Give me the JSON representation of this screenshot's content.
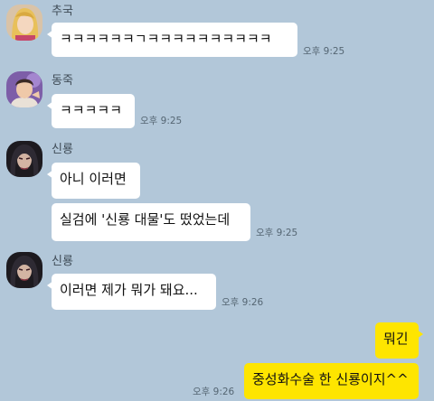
{
  "messages": [
    {
      "sender": "추국",
      "text": "ㅋㅋㅋㅋㅋㅋㄱㅋㅋㅋㅋㅋㅋㅋㅋㅋㅋ",
      "time": "오후 9:25"
    },
    {
      "sender": "동죽",
      "text": "ㅋㅋㅋㅋㅋ",
      "time": "오후 9:25"
    },
    {
      "sender": "신룡",
      "text": "아니 이러면"
    },
    {
      "text": "실검에 '신룡 대물'도 떴었는데",
      "time": "오후 9:25"
    },
    {
      "sender": "신룡",
      "text": "이러면 제가 뭐가 돼요...",
      "time": "오후 9:26"
    },
    {
      "text": "뭐긴"
    },
    {
      "text": "중성화수술 한 신룡이지^^",
      "time": "오후 9:26"
    }
  ]
}
